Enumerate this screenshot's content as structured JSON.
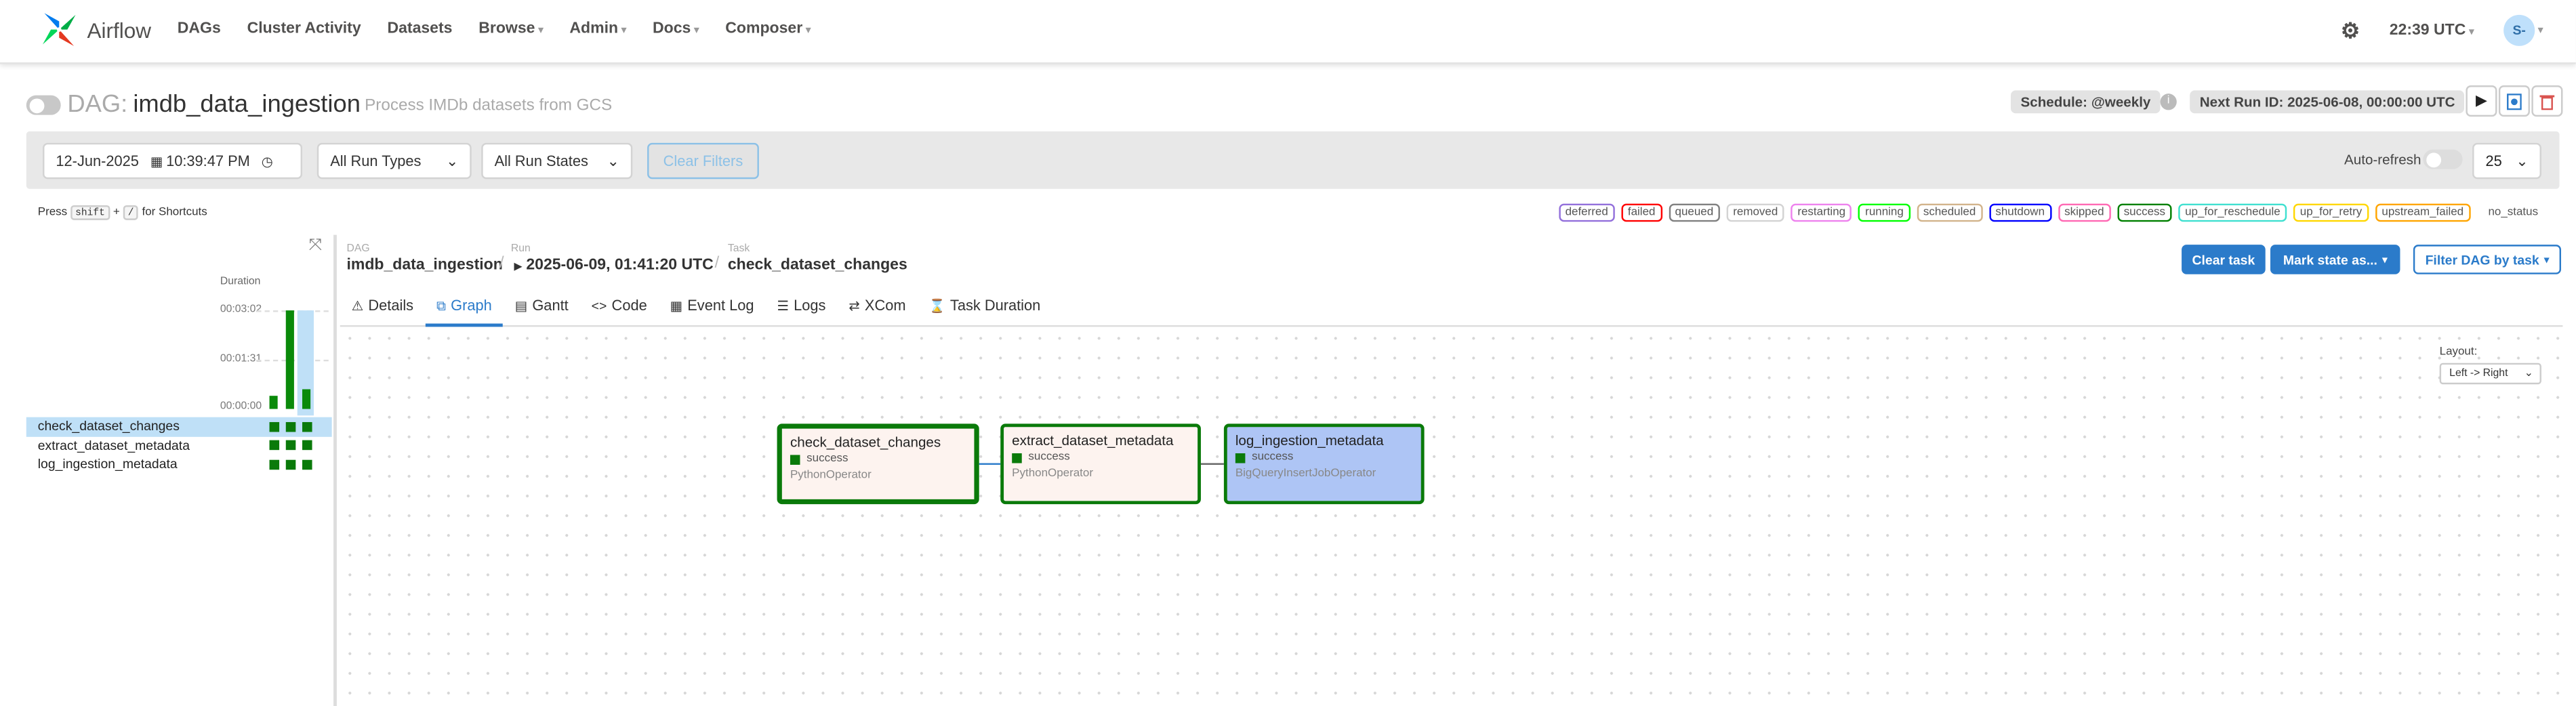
{
  "nav": {
    "brand": "Airflow",
    "links": [
      "DAGs",
      "Cluster Activity",
      "Datasets",
      "Browse",
      "Admin",
      "Docs",
      "Composer"
    ],
    "time": "22:39 UTC",
    "avatar": "S-"
  },
  "dag": {
    "label": "DAG:",
    "id": "imdb_data_ingestion",
    "description": "Process IMDb datasets from GCS",
    "schedule": "Schedule: @weekly",
    "next_run": "Next Run ID: 2025-06-08, 00:00:00 UTC"
  },
  "filters": {
    "date": "12-Jun-2025",
    "time": "10:39:47 PM",
    "run_types": "All Run Types",
    "run_states": "All Run States",
    "clear_filters": "Clear Filters",
    "auto_refresh": "Auto-refresh",
    "num_runs": "25"
  },
  "shortcuts": {
    "press": "Press",
    "key1": "shift",
    "plus": "+",
    "key2": "/",
    "suffix": "for Shortcuts"
  },
  "legend": [
    {
      "label": "deferred",
      "color": "#9370db"
    },
    {
      "label": "failed",
      "color": "#ff0000"
    },
    {
      "label": "queued",
      "color": "#808080"
    },
    {
      "label": "removed",
      "color": "#d3d3d3"
    },
    {
      "label": "restarting",
      "color": "#ee82ee"
    },
    {
      "label": "running",
      "color": "#00ff00"
    },
    {
      "label": "scheduled",
      "color": "#d2b48c"
    },
    {
      "label": "shutdown",
      "color": "#0000ff"
    },
    {
      "label": "skipped",
      "color": "#ff69b4"
    },
    {
      "label": "success",
      "color": "#008000"
    },
    {
      "label": "up_for_reschedule",
      "color": "#40e0d0"
    },
    {
      "label": "up_for_retry",
      "color": "#ffd700"
    },
    {
      "label": "upstream_failed",
      "color": "#ffa500"
    }
  ],
  "legend_plain": "no_status",
  "grid": {
    "duration_label": "Duration",
    "ticks": [
      "00:03:02",
      "00:01:31",
      "00:00:00"
    ],
    "tasks": [
      "check_dataset_changes",
      "extract_dataset_metadata",
      "log_ingestion_metadata"
    ]
  },
  "breadcrumbs": {
    "dag_small": "DAG",
    "dag": "imdb_data_ingestion",
    "run_small": "Run",
    "run": "2025-06-09, 01:41:20 UTC",
    "task_small": "Task",
    "task": "check_dataset_changes"
  },
  "actions": {
    "clear_task": "Clear task",
    "mark_state": "Mark state as...",
    "filter_dag": "Filter DAG by task"
  },
  "tabs": [
    "Details",
    "Graph",
    "Gantt",
    "Code",
    "Event Log",
    "Logs",
    "XCom",
    "Task Duration"
  ],
  "graph": {
    "layout_label": "Layout:",
    "layout_value": "Left -> Right",
    "nodes": [
      {
        "title": "check_dataset_changes",
        "state": "success",
        "operator": "PythonOperator"
      },
      {
        "title": "extract_dataset_metadata",
        "state": "success",
        "operator": "PythonOperator"
      },
      {
        "title": "log_ingestion_metadata",
        "state": "success",
        "operator": "BigQueryInsertJobOperator"
      }
    ]
  }
}
